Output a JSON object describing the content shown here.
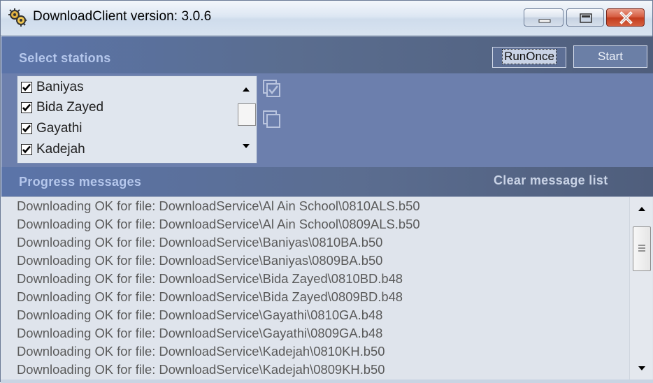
{
  "window": {
    "title": "DownloadClient version: 3.0.6",
    "icons": {
      "app": "gear-app-icon",
      "minimize": "minimize-icon",
      "maximize": "maximize-icon",
      "close": "close-icon"
    }
  },
  "stations": {
    "header": "Select stations",
    "run_once_label": "RunOnce",
    "start_label": "Start",
    "items": [
      {
        "label": "Baniyas",
        "checked": true
      },
      {
        "label": "Bida Zayed",
        "checked": true
      },
      {
        "label": "Gayathi",
        "checked": true
      },
      {
        "label": "Kadejah",
        "checked": true
      }
    ],
    "tools": [
      "check-all-icon",
      "uncheck-all-icon"
    ]
  },
  "progress": {
    "header": "Progress messages",
    "clear_label": "Clear message list",
    "messages": [
      "Downloading OK for file: DownloadService\\Al Ain School\\0810ALS.b50",
      "Downloading OK for file: DownloadService\\Al Ain School\\0809ALS.b50",
      "Downloading OK for file: DownloadService\\Baniyas\\0810BA.b50",
      "Downloading OK for file: DownloadService\\Baniyas\\0809BA.b50",
      "Downloading OK for file: DownloadService\\Bida Zayed\\0810BD.b48",
      "Downloading OK for file: DownloadService\\Bida Zayed\\0809BD.b48",
      "Downloading OK for file: DownloadService\\Gayathi\\0810GA.b48",
      "Downloading OK for file: DownloadService\\Gayathi\\0809GA.b48",
      "Downloading OK for file: DownloadService\\Kadejah\\0810KH.b50",
      "Downloading OK for file: DownloadService\\Kadejah\\0809KH.b50"
    ]
  },
  "colors": {
    "header_band": "#5b74a9",
    "station_area": "#6c7fad",
    "section_title": "#b5c7ec",
    "message_text": "#5a5a5a"
  }
}
